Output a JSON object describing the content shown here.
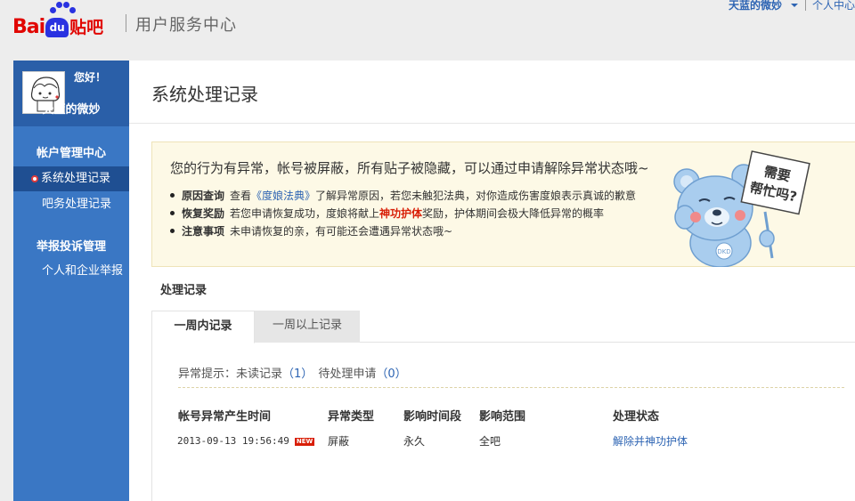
{
  "header": {
    "logo_bai": "Bai",
    "logo_du": "du",
    "logo_tieba": "贴吧",
    "title": "用户服务中心",
    "user_link": "天蓝的微妙",
    "personal_center": "个人中心"
  },
  "sidebar": {
    "greeting": "您好！",
    "username": "天蓝的微妙",
    "sections": [
      {
        "title": "帐户管理中心",
        "items": [
          {
            "label": "系统处理记录",
            "active": true
          },
          {
            "label": "吧务处理记录",
            "active": false
          }
        ]
      },
      {
        "title": "举报投诉管理",
        "items": [
          {
            "label": "个人和企业举报",
            "active": false
          }
        ]
      }
    ]
  },
  "main": {
    "page_title": "系统处理记录",
    "notice": {
      "headline": "您的行为有异常，帐号被屏蔽，所有贴子被隐藏，可以通过申请解除异常状态哦~",
      "items": [
        {
          "key": "原因查询",
          "pre": "查看",
          "link": "《度娘法典》",
          "post": "了解异常原因，若您未触犯法典，对你造成伤害度娘表示真诚的歉意"
        },
        {
          "key": "恢复奖励",
          "pre": "若您申请恢复成功，度娘将献上",
          "highlight": "神功护体",
          "post": "奖励，护体期间会极大降低异常的概率"
        },
        {
          "key": "注意事项",
          "text": "未申请恢复的亲，有可能还会遭遇异常状态哦~"
        }
      ],
      "help_sign": [
        "需要",
        "帮忙吗?"
      ],
      "bear_badge": "DKD"
    },
    "records_label": "处理记录",
    "tabs": [
      {
        "label": "一周内记录",
        "active": true
      },
      {
        "label": "一周以上记录",
        "active": false
      }
    ],
    "hint": {
      "prefix": "异常提示：",
      "unread_label": "未读记录",
      "unread_count": "（1）",
      "pending_label": "待处理申请",
      "pending_count": "（0）"
    },
    "table": {
      "columns": [
        "帐号异常产生时间",
        "异常类型",
        "影响时间段",
        "影响范围",
        "处理状态"
      ],
      "rows": [
        {
          "time": "2013-09-13 19:56:49",
          "badge": "NEW",
          "type": "屏蔽",
          "duration": "永久",
          "scope": "全吧",
          "status": "解除并神功护体"
        }
      ]
    }
  },
  "colors": {
    "sidebar_bg": "#3a77c4",
    "sidebar_active": "#1f4f92",
    "link": "#2d64b3",
    "brand_red": "#e10602",
    "notice_bg": "#fdf9e6"
  }
}
